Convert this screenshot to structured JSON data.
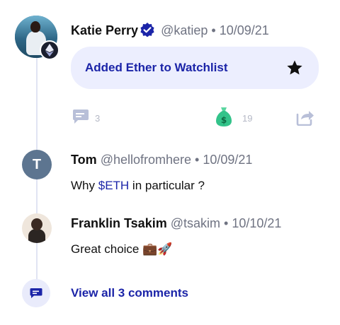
{
  "post": {
    "author_name": "Katie Perry",
    "handle": "@katiep",
    "separator": "•",
    "date": "10/09/21",
    "watchlist_text": "Added Ether to Watchlist",
    "comment_count": "3",
    "tip_count": "19"
  },
  "comments": [
    {
      "author_name": "Tom",
      "avatar_initial": "T",
      "handle": "@hellofromhere",
      "date": "10/09/21",
      "text_before": "Why ",
      "ticker": "$ETH",
      "text_after": " in particular ?"
    },
    {
      "author_name": "Franklin Tsakim",
      "handle": "@tsakim",
      "date": "10/10/21",
      "text": "Great choice",
      "emojis": "💼🚀"
    }
  ],
  "view_all_label": "View all 3 comments",
  "colors": {
    "accent": "#1b24a8",
    "card_bg": "#eceefe",
    "thread_line": "#e1e4f3",
    "muted_icon": "#b5b9c6",
    "money_green": "#33c38a"
  },
  "icons": [
    "ethereum-icon",
    "verified-icon",
    "star-icon",
    "comment-icon",
    "money-bag-icon",
    "share-icon",
    "comments-icon"
  ]
}
